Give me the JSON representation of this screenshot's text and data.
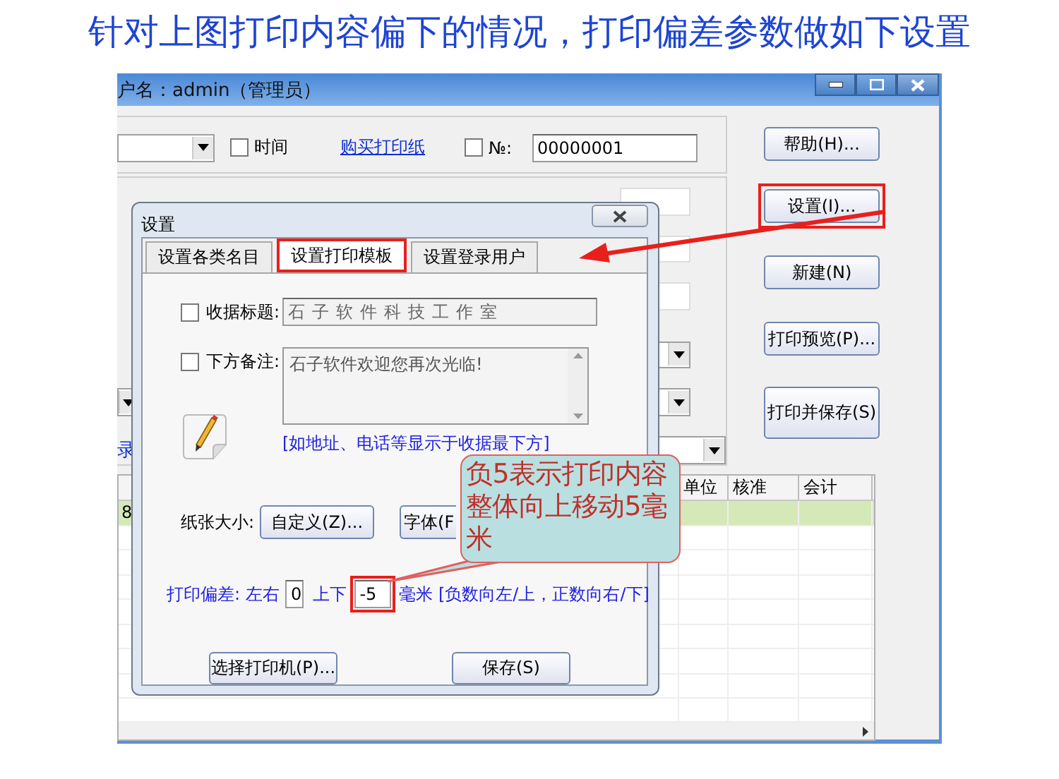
{
  "heading": "针对上图打印内容偏下的情况，打印偏差参数做如下设置",
  "main_window": {
    "title": "户名：admin（管理员）",
    "toolbar": {
      "time_checkbox": {
        "label": "时间",
        "checked": false
      },
      "link": "购买打印纸",
      "number_checkbox": {
        "label": "№:",
        "checked": false
      },
      "number_value": "00000001"
    },
    "side_label": "录",
    "buttons": [
      {
        "label": "帮助(H)...",
        "highlighted": false
      },
      {
        "label": "设置(I)...",
        "highlighted": true
      },
      {
        "label": "新建(N)",
        "highlighted": false
      },
      {
        "label": "打印预览(P)...",
        "highlighted": false
      },
      {
        "label": "打印并保存(S)",
        "highlighted": false
      }
    ],
    "table": {
      "columns": [
        "单位",
        "核准",
        "会计"
      ],
      "rows": [
        {
          "first_cell": "8",
          "selected": true
        }
      ]
    }
  },
  "dialog": {
    "title": "设置",
    "tabs": [
      {
        "label": "设置各类名目",
        "selected": false,
        "highlighted": false
      },
      {
        "label": "设置打印模板",
        "selected": true,
        "highlighted": true
      },
      {
        "label": "设置登录用户",
        "selected": false,
        "highlighted": false
      }
    ],
    "receipt_title": {
      "label": "收据标题:",
      "checked": false,
      "value": "石子软件科技工作室"
    },
    "footer_note": {
      "label": "下方备注:",
      "checked": false,
      "value": "石子软件欢迎您再次光临!"
    },
    "note_hint": "[如地址、电话等显示于收据最下方]",
    "paper_size": {
      "label": "纸张大小:",
      "button": "自定义(Z)..."
    },
    "font_button": "字体(F",
    "offset": {
      "label": "打印偏差:",
      "horizontal_label": "左右",
      "horizontal_value": "0",
      "vertical_label": "上下",
      "vertical_value": "-5",
      "vertical_highlighted": true,
      "unit_hint": "毫米 [负数向左/上，正数向右/下]"
    },
    "buttons": [
      "选择打印机(P)...",
      "保存(S)"
    ]
  },
  "callout": "负5表示打印内容整体向上移动5毫米"
}
